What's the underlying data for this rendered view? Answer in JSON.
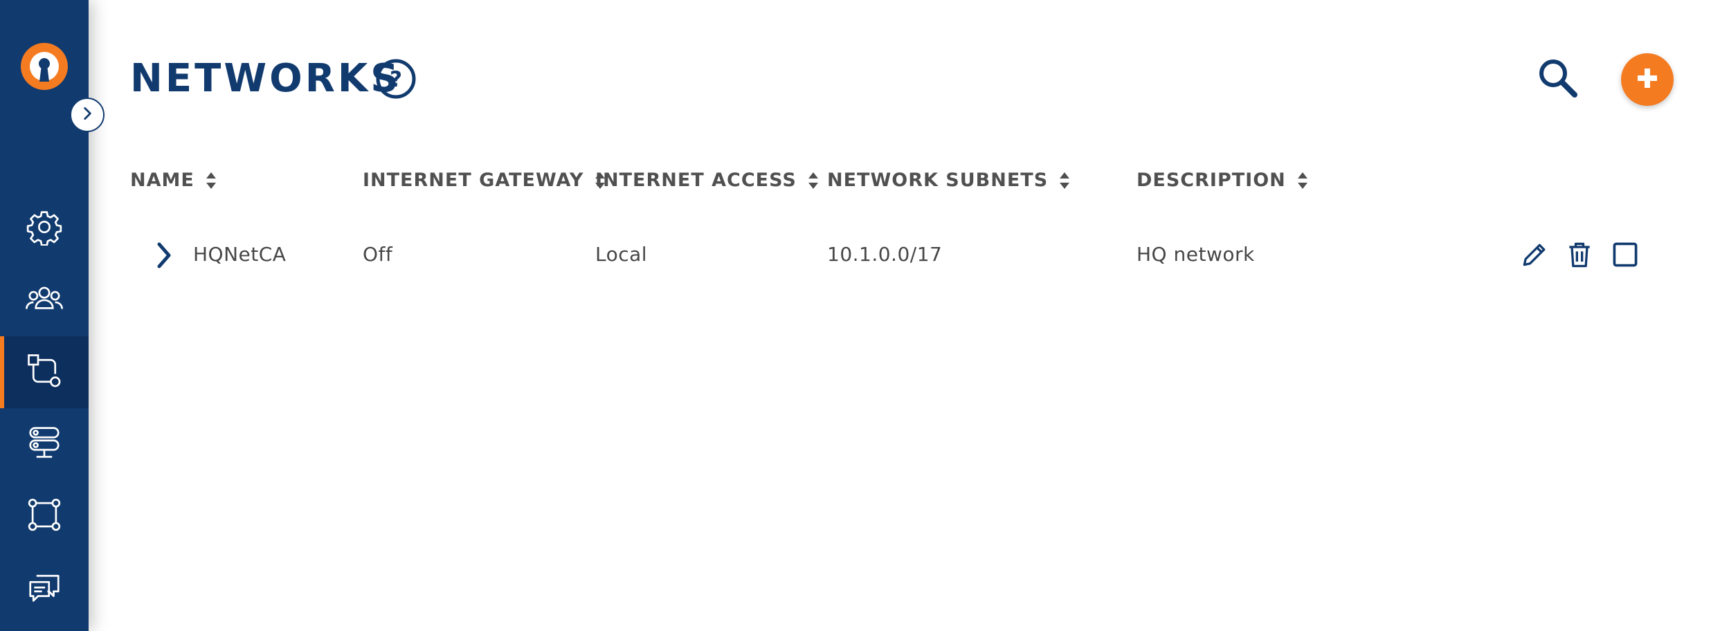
{
  "app": {
    "logo_icon": "keyhole-logo-icon",
    "expand_icon": "chevron-right-icon",
    "accent_color": "#f47b20",
    "brand_color": "#113a6e"
  },
  "sidebar": {
    "items": [
      {
        "icon": "gear-icon",
        "active": false
      },
      {
        "icon": "users-icon",
        "active": false
      },
      {
        "icon": "network-icon",
        "active": true
      },
      {
        "icon": "server-icon",
        "active": false
      },
      {
        "icon": "nodes-icon",
        "active": false
      },
      {
        "icon": "chat-icon",
        "active": false
      }
    ]
  },
  "header": {
    "title": "NETWORKS",
    "help_icon": "help-circle-icon",
    "search_icon": "search-icon",
    "add_icon": "plus-icon"
  },
  "table": {
    "columns": [
      "NAME",
      "INTERNET GATEWAY",
      "INTERNET ACCESS",
      "NETWORK SUBNETS",
      "DESCRIPTION"
    ],
    "rows": [
      {
        "name": "HQNetCA",
        "internet_gateway": "Off",
        "internet_access": "Local",
        "network_subnets": "10.1.0.0/17",
        "description": "HQ network",
        "actions": [
          "edit-icon",
          "trash-icon",
          "checkbox-icon"
        ]
      }
    ]
  }
}
